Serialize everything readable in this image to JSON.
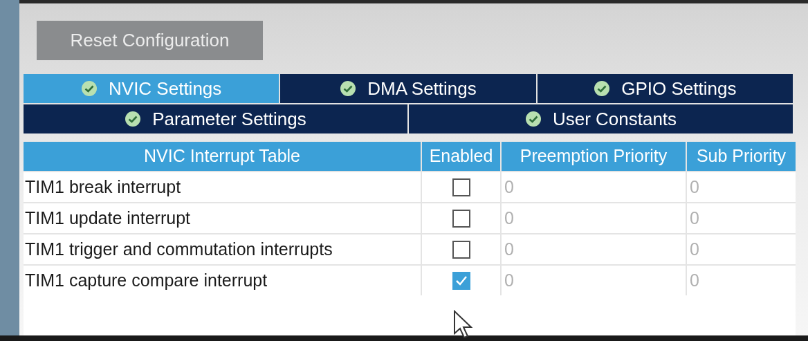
{
  "reset_button": {
    "label": "Reset Configuration"
  },
  "tab_rows": [
    [
      {
        "label": "NVIC Settings",
        "selected": true
      },
      {
        "label": "DMA Settings",
        "selected": false
      },
      {
        "label": "GPIO Settings",
        "selected": false
      }
    ],
    [
      {
        "label": "Parameter Settings",
        "selected": false
      },
      {
        "label": "User Constants",
        "selected": false
      }
    ]
  ],
  "table": {
    "columns": [
      "NVIC Interrupt Table",
      "Enabled",
      "Preemption Priority",
      "Sub Priority"
    ],
    "rows": [
      {
        "name": "TIM1 break interrupt",
        "checked": false,
        "preemption": "0",
        "sub": "0"
      },
      {
        "name": "TIM1 update interrupt",
        "checked": false,
        "preemption": "0",
        "sub": "0"
      },
      {
        "name": "TIM1 trigger and commutation interrupts",
        "checked": false,
        "preemption": "0",
        "sub": "0"
      },
      {
        "name": "TIM1 capture compare interrupt",
        "checked": true,
        "preemption": "0",
        "sub": "0"
      }
    ]
  }
}
